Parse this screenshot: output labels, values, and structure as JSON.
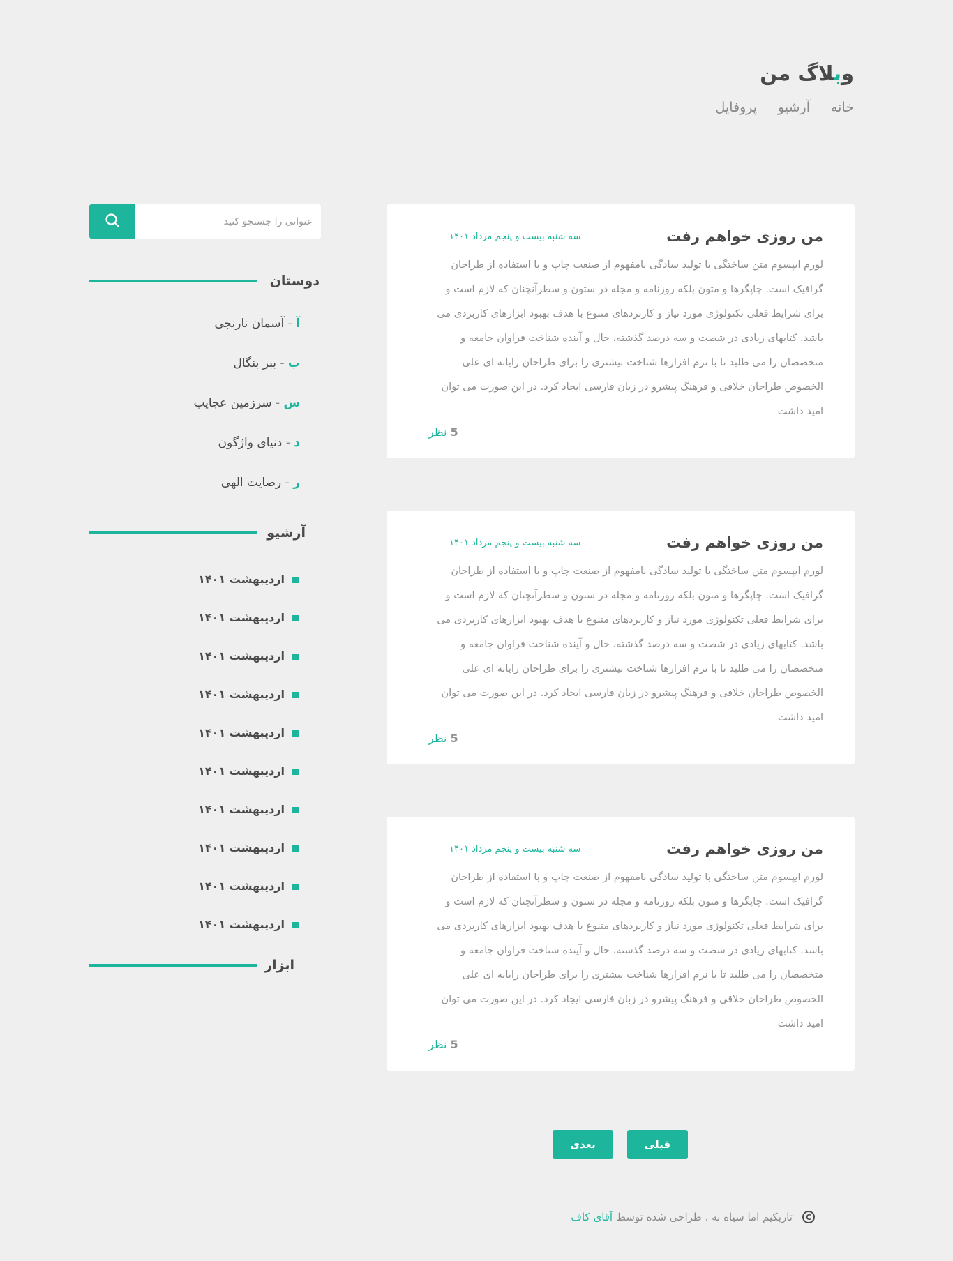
{
  "site": {
    "title_prefix": "و",
    "title_accent": "ب",
    "title_suffix": "لاگ من"
  },
  "nav": [
    "خانه",
    "آرشیو",
    "پروفایل"
  ],
  "posts": [
    {
      "title": "من روزی خواهم رفت",
      "date": "سه شنبه بیست و پنجم مرداد ۱۴۰۱",
      "body": "لورم ایپسوم متن ساختگی با تولید سادگی نامفهوم از صنعت چاپ و با استفاده از طراحان گرافیک است. چاپگرها و متون بلکه روزنامه و مجله در ستون و سطرآنچنان که لازم است و برای شرایط فعلی تکنولوژی مورد نیاز و کاربردهای متنوع با هدف بهبود ابزارهای کاربردی می باشد. کتابهای زیادی در شصت و سه درصد گذشته، حال و آینده شناخت فراوان جامعه و متخصصان را می طلبد تا با نرم افزارها شناخت بیشتری را برای طراحان رایانه ای علی الخصوص طراحان خلاقی و فرهنگ پیشرو در زبان فارسی ایجاد کرد. در این صورت می توان امید داشت",
      "comment_count": "5",
      "comment_label": "نظر"
    },
    {
      "title": "من روزی خواهم رفت",
      "date": "سه شنبه بیست و پنجم مرداد ۱۴۰۱",
      "body": "لورم ایپسوم متن ساختگی با تولید سادگی نامفهوم از صنعت چاپ و با استفاده از طراحان گرافیک است. چاپگرها و متون بلکه روزنامه و مجله در ستون و سطرآنچنان که لازم است و برای شرایط فعلی تکنولوژی مورد نیاز و کاربردهای متنوع با هدف بهبود ابزارهای کاربردی می باشد. کتابهای زیادی در شصت و سه درصد گذشته، حال و آینده شناخت فراوان جامعه و متخصصان را می طلبد تا با نرم افزارها شناخت بیشتری را برای طراحان رایانه ای علی الخصوص طراحان خلاقی و فرهنگ پیشرو در زبان فارسی ایجاد کرد. در این صورت می توان امید داشت",
      "comment_count": "5",
      "comment_label": "نظر"
    },
    {
      "title": "من روزی خواهم رفت",
      "date": "سه شنبه بیست و پنجم مرداد ۱۴۰۱",
      "body": "لورم ایپسوم متن ساختگی با تولید سادگی نامفهوم از صنعت چاپ و با استفاده از طراحان گرافیک است. چاپگرها و متون بلکه روزنامه و مجله در ستون و سطرآنچنان که لازم است و برای شرایط فعلی تکنولوژی مورد نیاز و کاربردهای متنوع با هدف بهبود ابزارهای کاربردی می باشد. کتابهای زیادی در شصت و سه درصد گذشته، حال و آینده شناخت فراوان جامعه و متخصصان را می طلبد تا با نرم افزارها شناخت بیشتری را برای طراحان رایانه ای علی الخصوص طراحان خلاقی و فرهنگ پیشرو در زبان فارسی ایجاد کرد. در این صورت می توان امید داشت",
      "comment_count": "5",
      "comment_label": "نظر"
    }
  ],
  "search": {
    "placeholder": "عنوانی را جستجو کنید",
    "value": "",
    "icon": "search-icon"
  },
  "sidebar": {
    "friends_title": "دوستان",
    "friends": [
      {
        "letter": "آ",
        "name": "آسمان نارنجی"
      },
      {
        "letter": "ب",
        "name": "ببر بنگال"
      },
      {
        "letter": "س",
        "name": "سرزمین عجایب"
      },
      {
        "letter": "د",
        "name": "دنیای واژگون"
      },
      {
        "letter": "ر",
        "name": "رضایت الهی"
      }
    ],
    "archive_title": "آرشیو",
    "archive": [
      "اردیبهشت ۱۴۰۱",
      "اردیبهشت ۱۴۰۱",
      "اردیبهشت ۱۴۰۱",
      "اردیبهشت ۱۴۰۱",
      "اردیبهشت ۱۴۰۱",
      "اردیبهشت ۱۴۰۱",
      "اردیبهشت ۱۴۰۱",
      "اردیبهشت ۱۴۰۱",
      "اردیبهشت ۱۴۰۱",
      "اردیبهشت ۱۴۰۱"
    ],
    "tools_title": "ابزار"
  },
  "pager": {
    "next_label": "بعدی",
    "prev_label": "قبلی"
  },
  "footer": {
    "copyright_symbol": "C",
    "text": "تاریکیم اما سیاه نه ، طراحی شده توسط",
    "author": "آقای کاف"
  },
  "colors": {
    "accent": "#1db69d",
    "background": "#efefef",
    "card": "#ffffff",
    "text": "#4a4a4a",
    "muted": "#8f8f8f"
  }
}
